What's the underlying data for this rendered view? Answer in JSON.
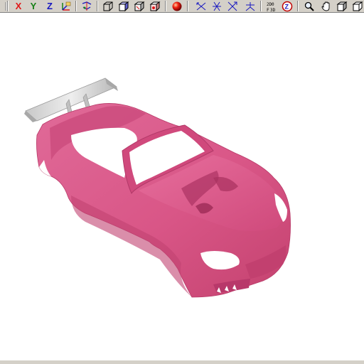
{
  "toolbar": {
    "axis_x": "X",
    "axis_y": "Y",
    "axis_z": "Z",
    "colors": {
      "x": "#e01818",
      "y": "#188018",
      "z": "#1818c0",
      "toolbar_bg": "#d4d0c8"
    },
    "icons": [
      "axis-xyz-icon",
      "rotate-axes-icon",
      "cube-wire-icon",
      "cube-shaded-icon",
      "cube-hidden-icon",
      "cube-texture-icon",
      "sphere-light-icon",
      "move-x-icon",
      "move-y-icon",
      "move-z-icon",
      "reset-view-icon",
      "front-back-icon",
      "zoom-icon",
      "search-icon",
      "pan-hand-icon",
      "cube-view-icon",
      "ortho-view-icon"
    ]
  },
  "viewport": {
    "model_name": "car-body",
    "body_color": "#d95687",
    "spoiler_color": "#d8d8d8",
    "background": "#ffffff"
  }
}
